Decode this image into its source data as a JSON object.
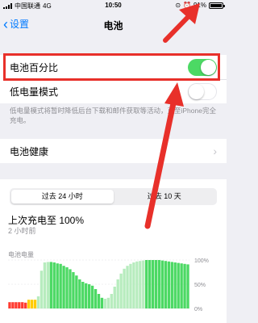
{
  "status_bar": {
    "carrier": "中国联通",
    "network": "4G",
    "time": "10:50",
    "battery_percent": "91%",
    "battery_level": 0.91
  },
  "nav": {
    "back_label": "设置",
    "title": "电池"
  },
  "settings": {
    "battery_percentage_label": "电池百分比",
    "battery_percentage_on": true,
    "low_power_label": "低电量模式",
    "low_power_on": false,
    "low_power_footnote": "低电量模式将暂时降低后台下载和邮件获取等活动，直至iPhone完全充电。",
    "battery_health_label": "电池健康"
  },
  "usage": {
    "tabs": [
      "过去 24 小时",
      "过去 10 天"
    ],
    "active_tab": 0,
    "last_charge_title": "上次充电至 100%",
    "last_charge_sub": "2 小时前",
    "chart_label": "电池电量"
  },
  "chart_data": {
    "type": "bar",
    "ylabel": "电池电量",
    "y_ticks": [
      "100%",
      "50%",
      "0%"
    ],
    "ylim": [
      0,
      100
    ],
    "values": [
      13,
      13,
      13,
      13,
      13,
      12,
      18,
      18,
      18,
      25,
      78,
      95,
      96,
      96,
      95,
      93,
      92,
      88,
      85,
      81,
      75,
      68,
      60,
      55,
      52,
      50,
      47,
      40,
      30,
      22,
      20,
      22,
      30,
      45,
      60,
      72,
      82,
      88,
      92,
      95,
      97,
      98,
      99,
      100,
      100,
      100,
      100,
      100,
      99,
      98,
      97,
      96,
      95,
      94,
      93,
      92,
      91
    ],
    "colors": {
      "normal": "#4cd964",
      "charging": "#b7ecbe",
      "low": "#ff3b30",
      "medium": "#ffcc00"
    }
  },
  "annotations": {
    "accent": "#e8302a"
  }
}
